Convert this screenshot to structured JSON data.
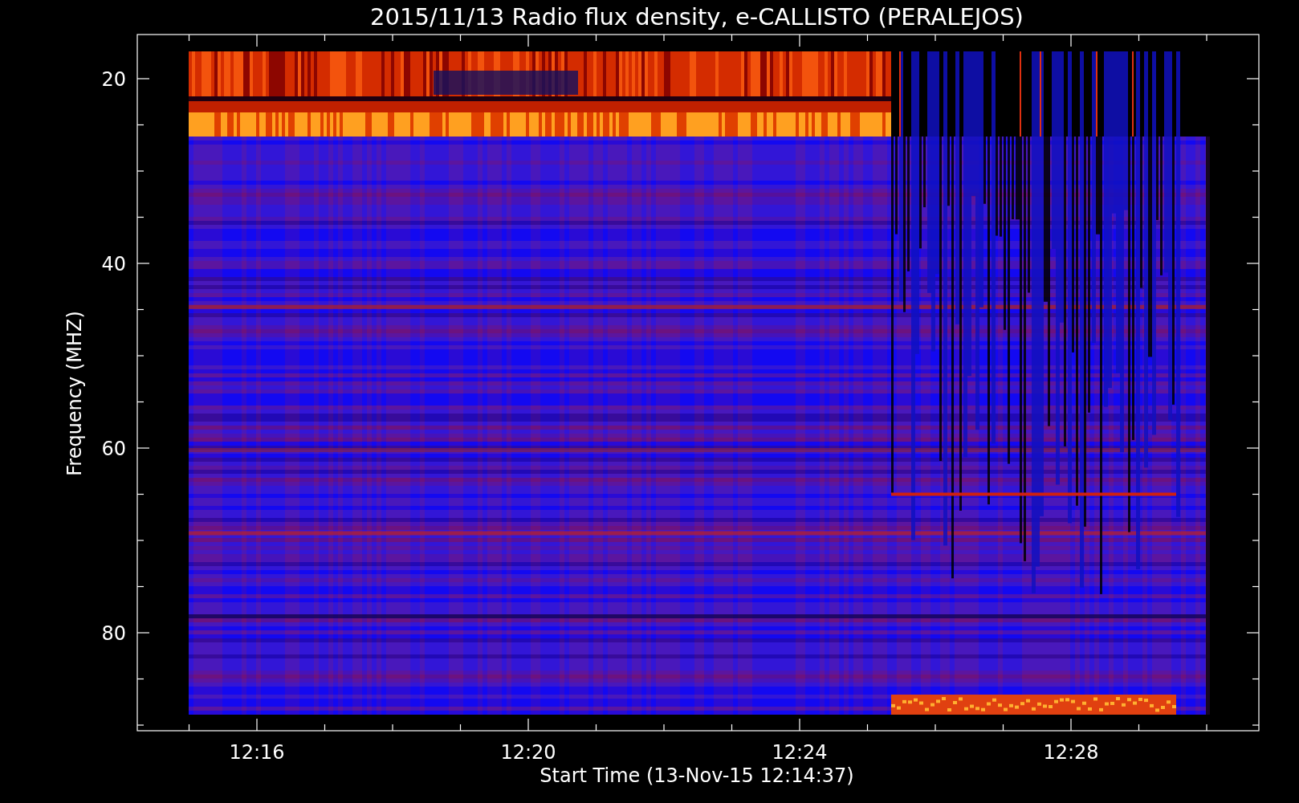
{
  "title": "2015/11/13  Radio flux density, e-CALLISTO (PERALEJOS)",
  "y_axis": {
    "label": "Frequency (MHZ)",
    "ticks": [
      "20",
      "40",
      "60",
      "80"
    ]
  },
  "x_axis": {
    "label": "Start Time (13-Nov-15 12:14:37)",
    "ticks": [
      "12:16",
      "12:20",
      "12:24",
      "12:28"
    ]
  }
}
